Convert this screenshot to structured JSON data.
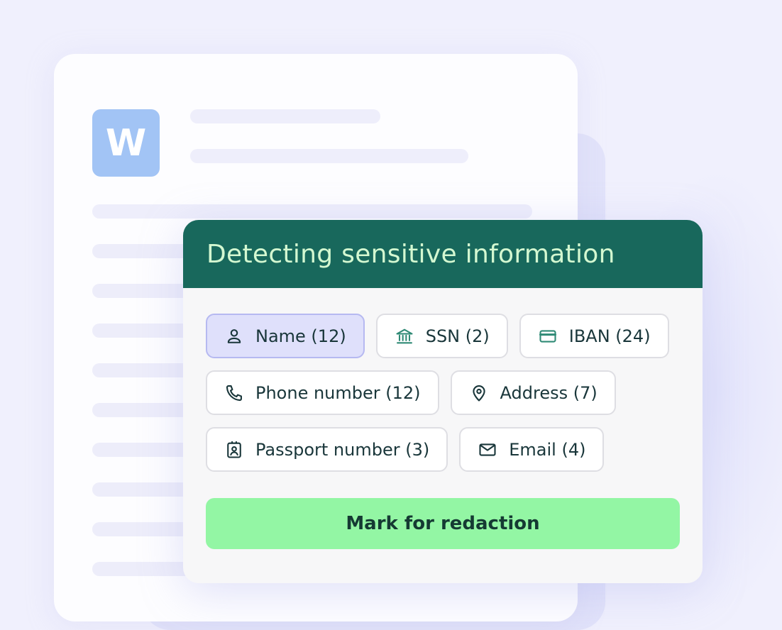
{
  "document": {
    "app_icon_letter": "W",
    "app_icon_color": "#a2c4f5"
  },
  "panel": {
    "title": "Detecting sensitive information",
    "header_color": "#18685c",
    "chips": [
      {
        "label": "Name (12)",
        "icon": "person-icon",
        "selected": true
      },
      {
        "label": "SSN (2)",
        "icon": "bank-icon",
        "selected": false
      },
      {
        "label": "IBAN (24)",
        "icon": "credit-card-icon",
        "selected": false
      },
      {
        "label": "Phone number (12)",
        "icon": "phone-icon",
        "selected": false
      },
      {
        "label": "Address (7)",
        "icon": "location-pin-icon",
        "selected": false
      },
      {
        "label": "Passport number (3)",
        "icon": "id-badge-icon",
        "selected": false
      },
      {
        "label": "Email (4)",
        "icon": "mail-icon",
        "selected": false
      }
    ],
    "action_button": "Mark for redaction",
    "action_color": "#93f6a4"
  }
}
